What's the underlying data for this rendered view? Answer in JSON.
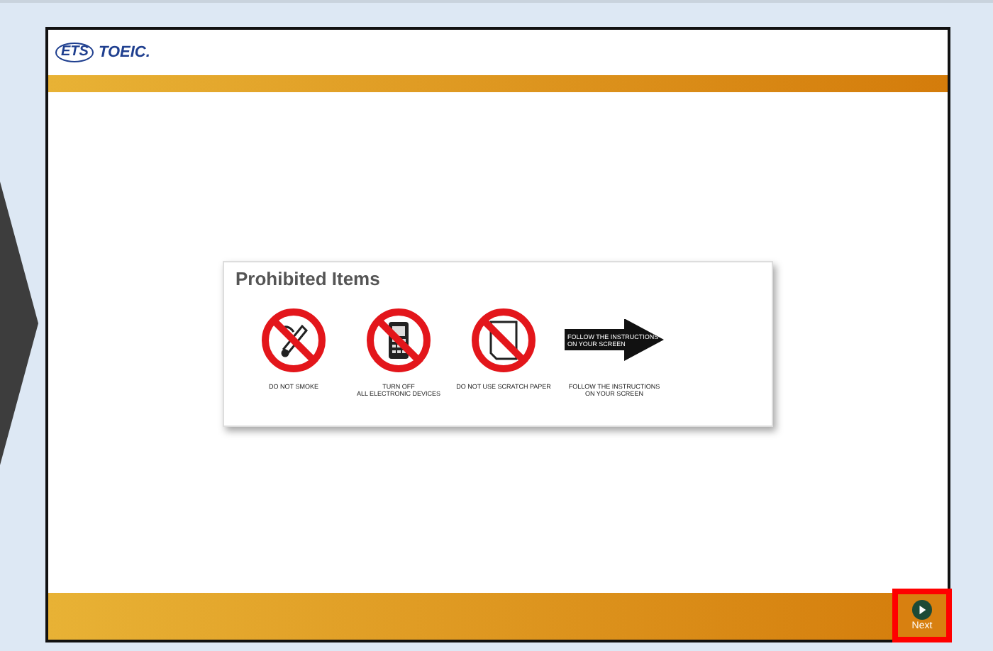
{
  "header": {
    "logo_badge": "ETS",
    "logo_text": "TOEIC."
  },
  "panel": {
    "title": "Prohibited Items",
    "items": [
      {
        "kind": "no-smoking",
        "caption": "DO NOT SMOKE"
      },
      {
        "kind": "no-phone",
        "caption": "TURN OFF\nALL ELECTRONIC DEVICES"
      },
      {
        "kind": "no-paper",
        "caption": "DO NOT USE SCRATCH PAPER"
      },
      {
        "kind": "arrow",
        "sign_text": "FOLLOW THE INSTRUCTIONS\nON YOUR SCREEN",
        "caption": "FOLLOW THE INSTRUCTIONS\nON YOUR SCREEN"
      }
    ]
  },
  "footer": {
    "next_button": {
      "label": "Next"
    }
  }
}
